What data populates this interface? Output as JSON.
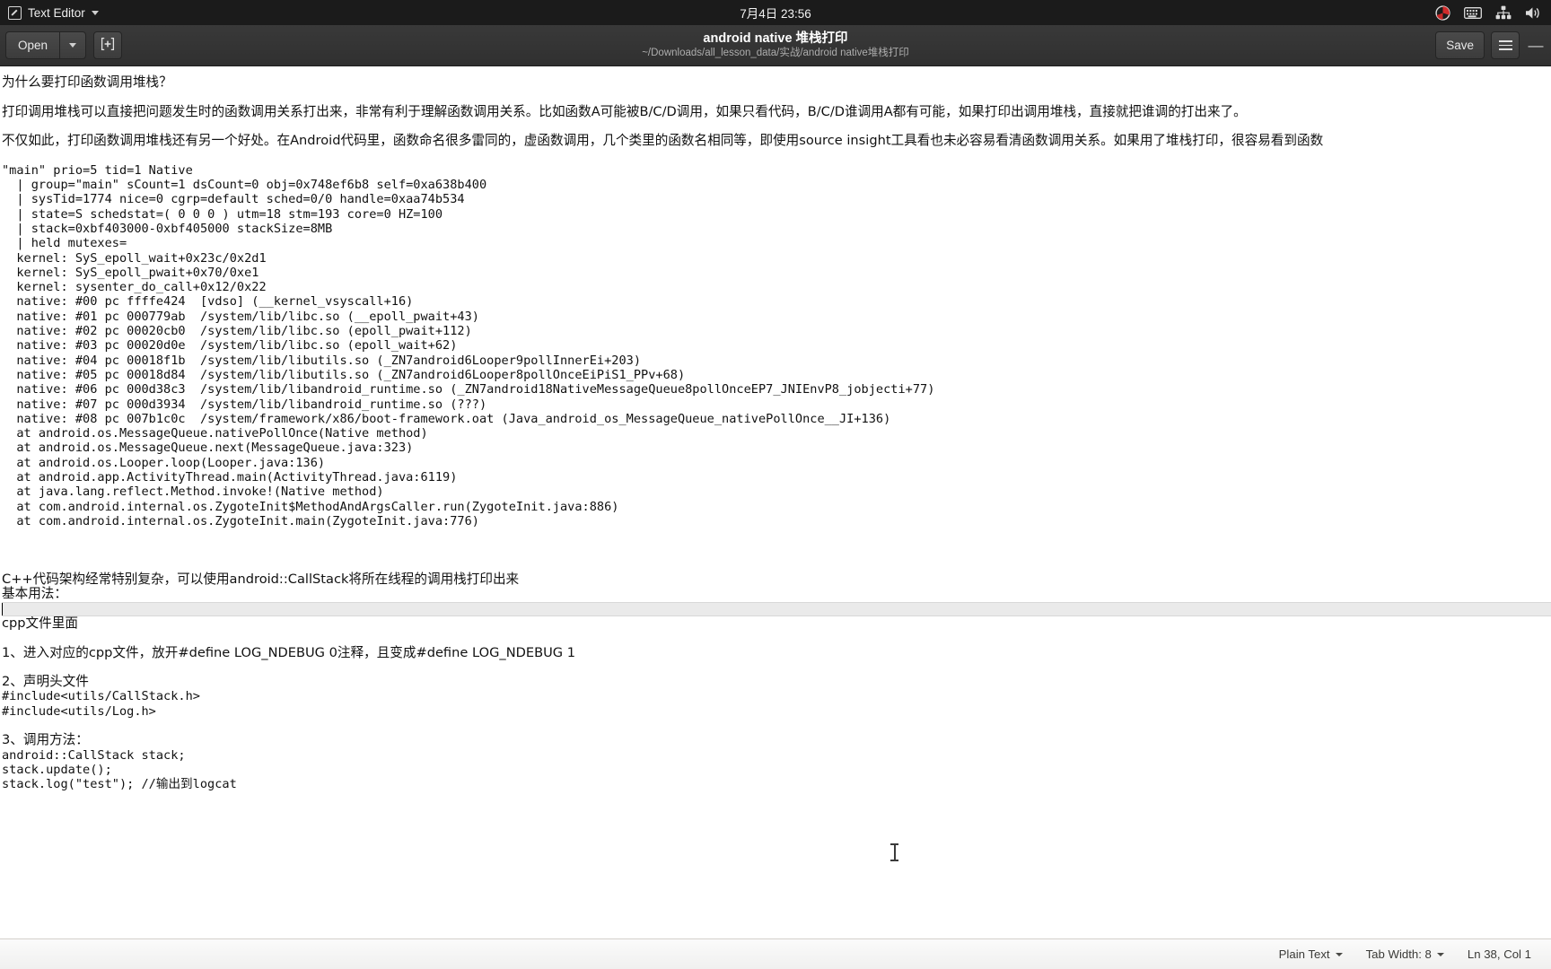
{
  "top_panel": {
    "app_name": "Text Editor",
    "app_icon": "text-editor-icon",
    "clock": "7月4日  23:56",
    "tray_icons": [
      "recording-indicator-icon",
      "keyboard-icon",
      "network-icon",
      "volume-icon"
    ]
  },
  "headerbar": {
    "open_label": "Open",
    "open_dropdown_icon": "chevron-down-icon",
    "new_tab_icon": "new-document-icon",
    "title": "android native 堆栈打印",
    "subtitle": "~/Downloads/all_lesson_data/实战/android native堆栈打印",
    "save_label": "Save",
    "menu_icon": "hamburger-menu-icon",
    "minimize_label": "—"
  },
  "statusbar": {
    "language": "Plain Text",
    "tab_width": "Tab Width: 8",
    "position": "Ln 38, Col 1"
  },
  "document": {
    "lines": [
      {
        "type": "cjk",
        "text": "为什么要打印函数调用堆栈？"
      },
      {
        "type": "blank",
        "text": ""
      },
      {
        "type": "cjk",
        "text": "打印调用堆栈可以直接把问题发生时的函数调用关系打出来，非常有利于理解函数调用关系。比如函数A可能被B/C/D调用，如果只看代码，B/C/D谁调用A都有可能，如果打印出调用堆栈，直接就把谁调的打出来了。"
      },
      {
        "type": "blank",
        "text": ""
      },
      {
        "type": "cjk",
        "text": "不仅如此，打印函数调用堆栈还有另一个好处。在Android代码里，函数命名很多雷同的，虚函数调用，几个类里的函数名相同等，即使用source insight工具看也未必容易看清函数调用关系。如果用了堆栈打印，很容易看到函数"
      },
      {
        "type": "blank",
        "text": ""
      },
      {
        "type": "mono",
        "text": "\"main\" prio=5 tid=1 Native"
      },
      {
        "type": "mono",
        "text": "  | group=\"main\" sCount=1 dsCount=0 obj=0x748ef6b8 self=0xa638b400"
      },
      {
        "type": "mono",
        "text": "  | sysTid=1774 nice=0 cgrp=default sched=0/0 handle=0xaa74b534"
      },
      {
        "type": "mono",
        "text": "  | state=S schedstat=( 0 0 0 ) utm=18 stm=193 core=0 HZ=100"
      },
      {
        "type": "mono",
        "text": "  | stack=0xbf403000-0xbf405000 stackSize=8MB"
      },
      {
        "type": "mono",
        "text": "  | held mutexes="
      },
      {
        "type": "mono",
        "text": "  kernel: SyS_epoll_wait+0x23c/0x2d1"
      },
      {
        "type": "mono",
        "text": "  kernel: SyS_epoll_pwait+0x70/0xe1"
      },
      {
        "type": "mono",
        "text": "  kernel: sysenter_do_call+0x12/0x22"
      },
      {
        "type": "mono",
        "text": "  native: #00 pc ffffe424  [vdso] (__kernel_vsyscall+16)"
      },
      {
        "type": "mono",
        "text": "  native: #01 pc 000779ab  /system/lib/libc.so (__epoll_pwait+43)"
      },
      {
        "type": "mono",
        "text": "  native: #02 pc 00020cb0  /system/lib/libc.so (epoll_pwait+112)"
      },
      {
        "type": "mono",
        "text": "  native: #03 pc 00020d0e  /system/lib/libc.so (epoll_wait+62)"
      },
      {
        "type": "mono",
        "text": "  native: #04 pc 00018f1b  /system/lib/libutils.so (_ZN7android6Looper9pollInnerEi+203)"
      },
      {
        "type": "mono",
        "text": "  native: #05 pc 00018d84  /system/lib/libutils.so (_ZN7android6Looper8pollOnceEiPiS1_PPv+68)"
      },
      {
        "type": "mono",
        "text": "  native: #06 pc 000d38c3  /system/lib/libandroid_runtime.so (_ZN7android18NativeMessageQueue8pollOnceEP7_JNIEnvP8_jobjecti+77)"
      },
      {
        "type": "mono",
        "text": "  native: #07 pc 000d3934  /system/lib/libandroid_runtime.so (???)"
      },
      {
        "type": "mono",
        "text": "  native: #08 pc 007b1c0c  /system/framework/x86/boot-framework.oat (Java_android_os_MessageQueue_nativePollOnce__JI+136)"
      },
      {
        "type": "mono",
        "text": "  at android.os.MessageQueue.nativePollOnce(Native method)"
      },
      {
        "type": "mono",
        "text": "  at android.os.MessageQueue.next(MessageQueue.java:323)"
      },
      {
        "type": "mono",
        "text": "  at android.os.Looper.loop(Looper.java:136)"
      },
      {
        "type": "mono",
        "text": "  at android.app.ActivityThread.main(ActivityThread.java:6119)"
      },
      {
        "type": "mono",
        "text": "  at java.lang.reflect.Method.invoke!(Native method)"
      },
      {
        "type": "mono",
        "text": "  at com.android.internal.os.ZygoteInit$MethodAndArgsCaller.run(ZygoteInit.java:886)"
      },
      {
        "type": "mono",
        "text": "  at com.android.internal.os.ZygoteInit.main(ZygoteInit.java:776)"
      },
      {
        "type": "blank",
        "text": ""
      },
      {
        "type": "blank",
        "text": ""
      },
      {
        "type": "blank",
        "text": ""
      },
      {
        "type": "cjk",
        "text": "C++代码架构经常特别复杂，可以使用android::CallStack将所在线程的调用栈打印出来"
      },
      {
        "type": "cjk",
        "text": "基本用法："
      },
      {
        "type": "current",
        "text": ""
      },
      {
        "type": "cjk",
        "text": "cpp文件里面"
      },
      {
        "type": "blank",
        "text": ""
      },
      {
        "type": "cjk",
        "text": "1、进入对应的cpp文件，放开#define LOG_NDEBUG 0注释，且变成#define LOG_NDEBUG 1"
      },
      {
        "type": "blank",
        "text": ""
      },
      {
        "type": "cjk",
        "text": "2、声明头文件"
      },
      {
        "type": "mono",
        "text": "#include<utils/CallStack.h>"
      },
      {
        "type": "mono",
        "text": "#include<utils/Log.h>"
      },
      {
        "type": "blank",
        "text": ""
      },
      {
        "type": "cjk",
        "text": "3、调用方法："
      },
      {
        "type": "mono",
        "text": "android::CallStack stack;"
      },
      {
        "type": "mono",
        "text": "stack.update();"
      },
      {
        "type": "mono",
        "text": "stack.log(\"test\"); //输出到logcat"
      }
    ]
  }
}
